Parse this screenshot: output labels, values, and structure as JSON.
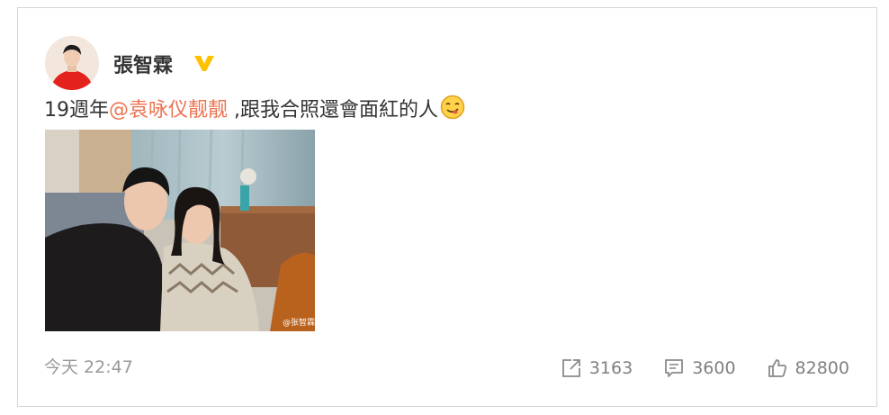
{
  "post": {
    "author": "張智霖",
    "verified_color": "#ffc000",
    "text_prefix": "19週年",
    "mention": "@袁咏仪靓靓",
    "text_suffix": " ,跟我合照還會面紅的人",
    "emoji": "smirk-emoji",
    "photo_watermark": "@张智霖",
    "timestamp": "今天 22:47",
    "mention_color": "#eb7350"
  },
  "actions": {
    "repost": {
      "icon": "share-icon",
      "count": "3163"
    },
    "comment": {
      "icon": "comment-icon",
      "count": "3600"
    },
    "like": {
      "icon": "thumbs-up-icon",
      "count": "82800"
    }
  }
}
